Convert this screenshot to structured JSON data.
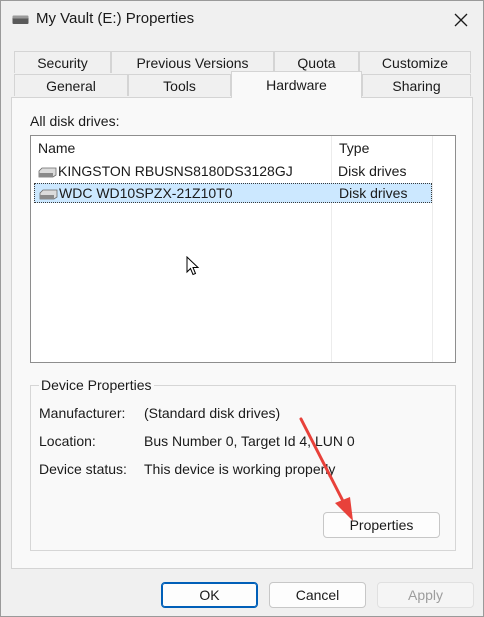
{
  "window": {
    "title": "My Vault (E:) Properties",
    "close_icon": "close-icon",
    "drive_icon": "drive-icon"
  },
  "tabs": {
    "row1": [
      "Security",
      "Previous Versions",
      "Quota",
      "Customize"
    ],
    "row2": [
      "General",
      "Tools",
      "Hardware",
      "Sharing"
    ],
    "active": "Hardware"
  },
  "drives": {
    "label": "All disk drives:",
    "columns": {
      "name": "Name",
      "type": "Type"
    },
    "rows": [
      {
        "name": "KINGSTON RBUSNS8180DS3128GJ",
        "type": "Disk drives",
        "selected": false
      },
      {
        "name": "WDC WD10SPZX-21Z10T0",
        "type": "Disk drives",
        "selected": true
      }
    ]
  },
  "device_properties": {
    "title": "Device Properties",
    "manufacturer_label": "Manufacturer:",
    "manufacturer_value": "(Standard disk drives)",
    "location_label": "Location:",
    "location_value": "Bus Number 0, Target Id 4, LUN 0",
    "status_label": "Device status:",
    "status_value": "This device is working properly",
    "properties_button": "Properties"
  },
  "buttons": {
    "ok": "OK",
    "cancel": "Cancel",
    "apply": "Apply"
  },
  "colors": {
    "selection": "#cce8ff",
    "accent": "#005fb8",
    "annotation_arrow": "#e8413a"
  }
}
